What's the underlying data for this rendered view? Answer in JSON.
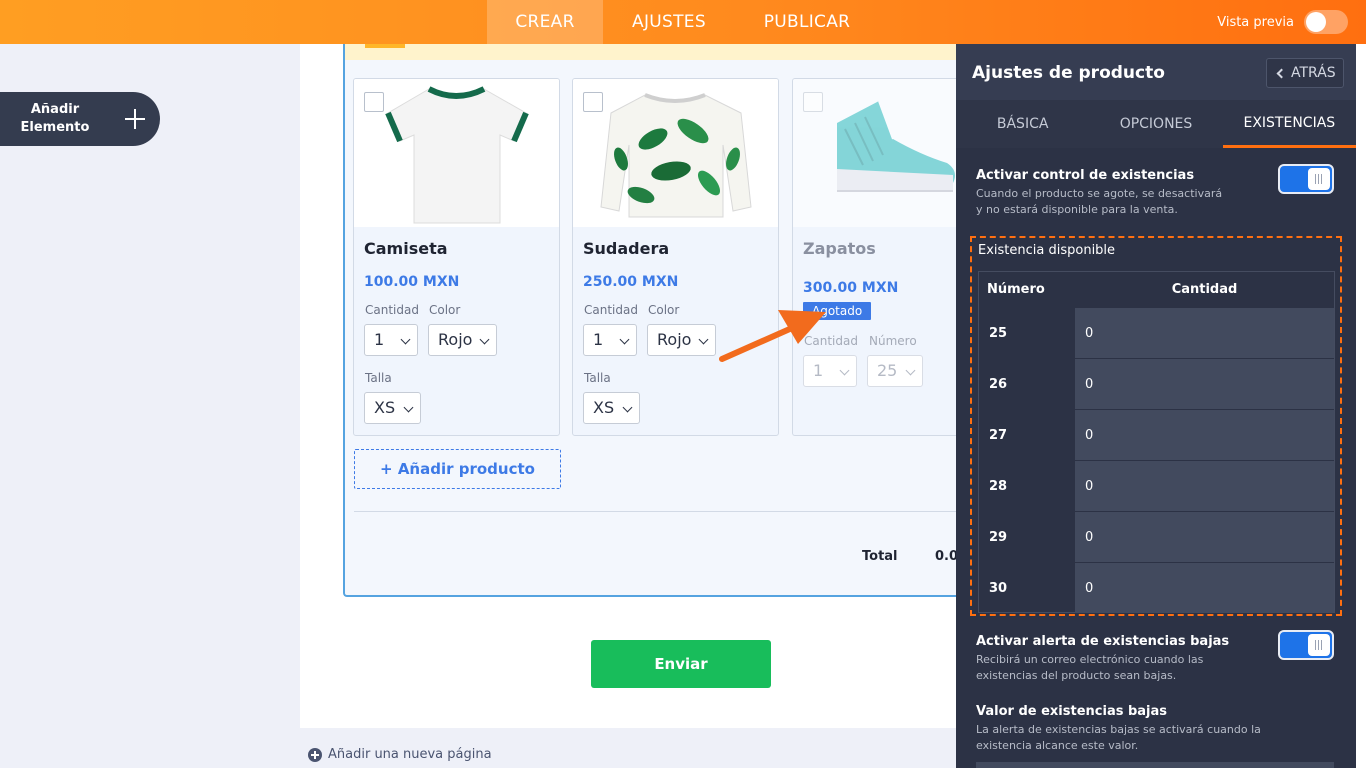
{
  "topbar": {
    "tabs": [
      {
        "label": "CREAR",
        "active": true
      },
      {
        "label": "AJUSTES",
        "active": false
      },
      {
        "label": "PUBLICAR",
        "active": false
      }
    ],
    "preview_label": "Vista previa"
  },
  "sidebar": {
    "add_element_line1": "Añadir",
    "add_element_line2": "Elemento"
  },
  "products": [
    {
      "name": "Camiseta",
      "price": "100.00 MXN",
      "fields": {
        "qty_label": "Cantidad",
        "qty": "1",
        "color_label": "Color",
        "color": "Rojo",
        "size_label": "Talla",
        "size": "XS"
      }
    },
    {
      "name": "Sudadera",
      "price": "250.00 MXN",
      "fields": {
        "qty_label": "Cantidad",
        "qty": "1",
        "color_label": "Color",
        "color": "Rojo",
        "size_label": "Talla",
        "size": "XS"
      }
    },
    {
      "name": "Zapatos",
      "price": "300.00 MXN",
      "badge": "Agotado",
      "fields": {
        "qty_label": "Cantidad",
        "qty": "1",
        "number_label": "Número",
        "number": "25"
      }
    }
  ],
  "form": {
    "add_product": "+ Añadir producto",
    "total_label": "Total",
    "total_value": "0.0",
    "submit": "Enviar",
    "add_page": "Añadir una nueva página"
  },
  "panel": {
    "title": "Ajustes de producto",
    "back": "ATRÁS",
    "tabs": [
      {
        "label": "BÁSICA",
        "active": false
      },
      {
        "label": "OPCIONES",
        "active": false
      },
      {
        "label": "EXISTENCIAS",
        "active": true
      }
    ],
    "stock_control": {
      "title": "Activar control de existencias",
      "desc": "Cuando el producto se agote, se desactivará y no estará disponible para la venta.",
      "enabled": true
    },
    "available_stock": {
      "title": "Existencia disponible",
      "col_number": "Número",
      "col_qty": "Cantidad",
      "rows": [
        {
          "number": "25",
          "qty": "0"
        },
        {
          "number": "26",
          "qty": "0"
        },
        {
          "number": "27",
          "qty": "0"
        },
        {
          "number": "28",
          "qty": "0"
        },
        {
          "number": "29",
          "qty": "0"
        },
        {
          "number": "30",
          "qty": "0"
        }
      ]
    },
    "low_stock_alert": {
      "title": "Activar alerta de existencias bajas",
      "desc": "Recibirá un correo electrónico cuando las existencias del producto sean bajas.",
      "enabled": true
    },
    "low_stock_value": {
      "title": "Valor de existencias bajas",
      "desc": "La alerta de existencias bajas se activará cuando la existencia alcance este valor."
    }
  },
  "colors": {
    "accent_orange": "#ff6f10",
    "panel_bg": "#2c3245",
    "link_blue": "#3d7ae6",
    "submit_green": "#18bd5b"
  }
}
